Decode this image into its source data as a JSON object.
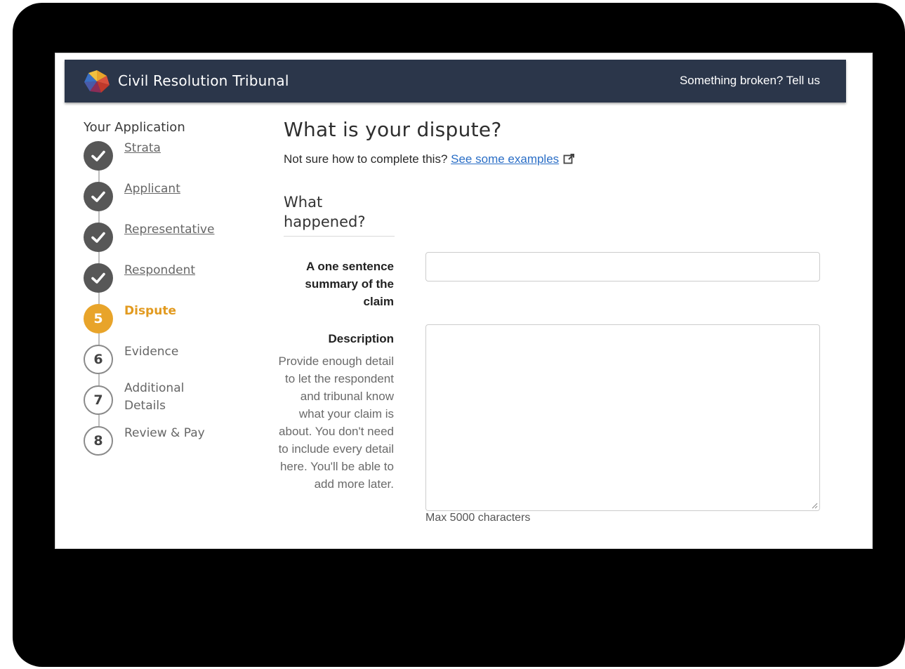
{
  "header": {
    "brand": "Civil Resolution Tribunal",
    "report_link": "Something broken? Tell us"
  },
  "sidebar": {
    "title": "Your Application",
    "steps": [
      {
        "label": "Strata",
        "status": "done"
      },
      {
        "label": "Applicant",
        "status": "done"
      },
      {
        "label": "Representative",
        "status": "done"
      },
      {
        "label": "Respondent",
        "status": "done"
      },
      {
        "label": "Dispute",
        "status": "active",
        "number": "5"
      },
      {
        "label": "Evidence",
        "status": "todo",
        "number": "6"
      },
      {
        "label": "Additional Details",
        "status": "todo",
        "number": "7"
      },
      {
        "label": "Review & Pay",
        "status": "todo",
        "number": "8"
      }
    ]
  },
  "main": {
    "title": "What is your dispute?",
    "help_text": "Not sure how to complete this?",
    "help_link": "See some examples",
    "section_title": "What happened?",
    "summary_label": "A one sentence summary of the claim",
    "summary_value": "",
    "description_label": "Description",
    "description_help": "Provide enough detail to let the respondent and tribunal know what your claim is about. You don't need to include every detail here. You'll be able to add more later.",
    "description_value": "",
    "max_chars_note": "Max 5000 characters"
  },
  "colors": {
    "header_bg": "#2b364a",
    "active_step": "#e8a42a",
    "done_step": "#575757",
    "link": "#2a6ec6"
  }
}
